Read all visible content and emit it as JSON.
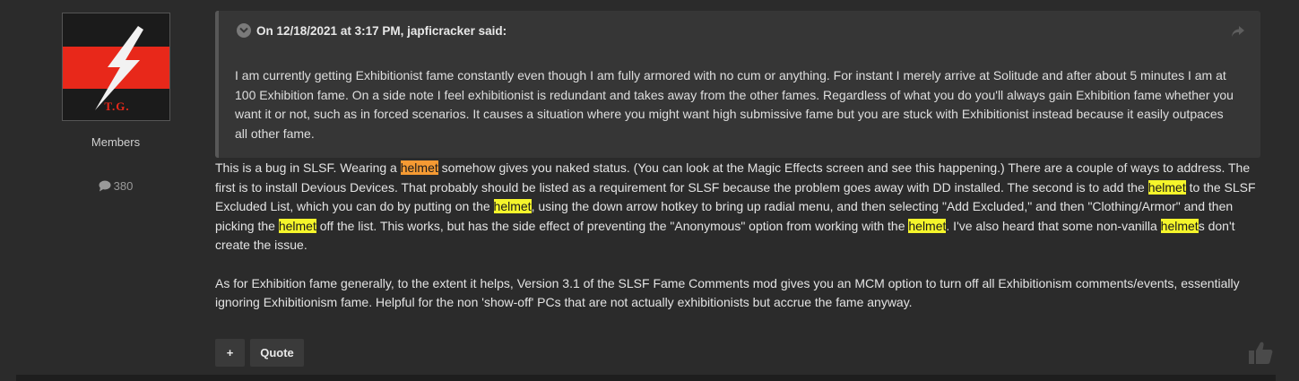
{
  "author": {
    "avatar_text": "T.G.",
    "group": "Members",
    "post_count": "380"
  },
  "quote": {
    "header": "On 12/18/2021 at 3:17 PM, japficracker said:",
    "body": "I am currently getting Exhibitionist fame constantly even though I am fully armored with no cum or anything. For instant I merely arrive at Solitude and after about 5 minutes I am at 100 Exhibition fame. On a side note I feel exhibitionist is redundant and takes away from the other fames. Regardless of what you do you'll always gain Exhibition fame whether you want it or not, such as in forced scenarios. It causes a situation where you might want high submissive fame but you are stuck with Exhibitionist instead because it easily outpaces all other fame."
  },
  "post": {
    "p1": {
      "t1": "This is a bug in SLSF. Wearing a ",
      "h1": "helmet",
      "t2": " somehow gives you naked status. (You can look at the Magic Effects screen and see this happening.) There are a couple of ways to address. The first is to install Devious Devices. That probably should be listed as a requirement for SLSF because the problem goes away with DD installed. The second is to add the ",
      "h2": "helmet",
      "t3": " to the SLSF Excluded List, which you can do by putting on the ",
      "h3": "helmet",
      "t4": ", using the down arrow hotkey to bring up radial menu, and then selecting \"Add Excluded,\" and then \"Clothing/Armor\" and then picking the ",
      "h4": "helmet",
      "t5": " off the list. This works, but has the side effect of preventing the \"Anonymous\" option from working with the ",
      "h5": "helmet",
      "t6": ".  I've also heard that some non-vanilla ",
      "h6": "helmet",
      "t7": "s don't create the issue."
    },
    "p2": "As for Exhibition fame generally, to the extent it helps, Version 3.1 of the SLSF Fame Comments mod gives you an MCM option to turn off all Exhibitionism comments/events, essentially ignoring Exhibitionism fame. Helpful for the non 'show-off' PCs that are not actually exhibitionists but accrue the fame anyway."
  },
  "actions": {
    "plus_label": "+",
    "quote_label": "Quote"
  },
  "icons": {
    "comment": "comment-icon",
    "share": "share-icon",
    "like": "thumbs-up-icon",
    "collapse": "chevron-down-icon"
  },
  "colors": {
    "highlight": "#f5f52b",
    "highlight_current": "#f59a33",
    "avatar_red": "#e8281a"
  }
}
